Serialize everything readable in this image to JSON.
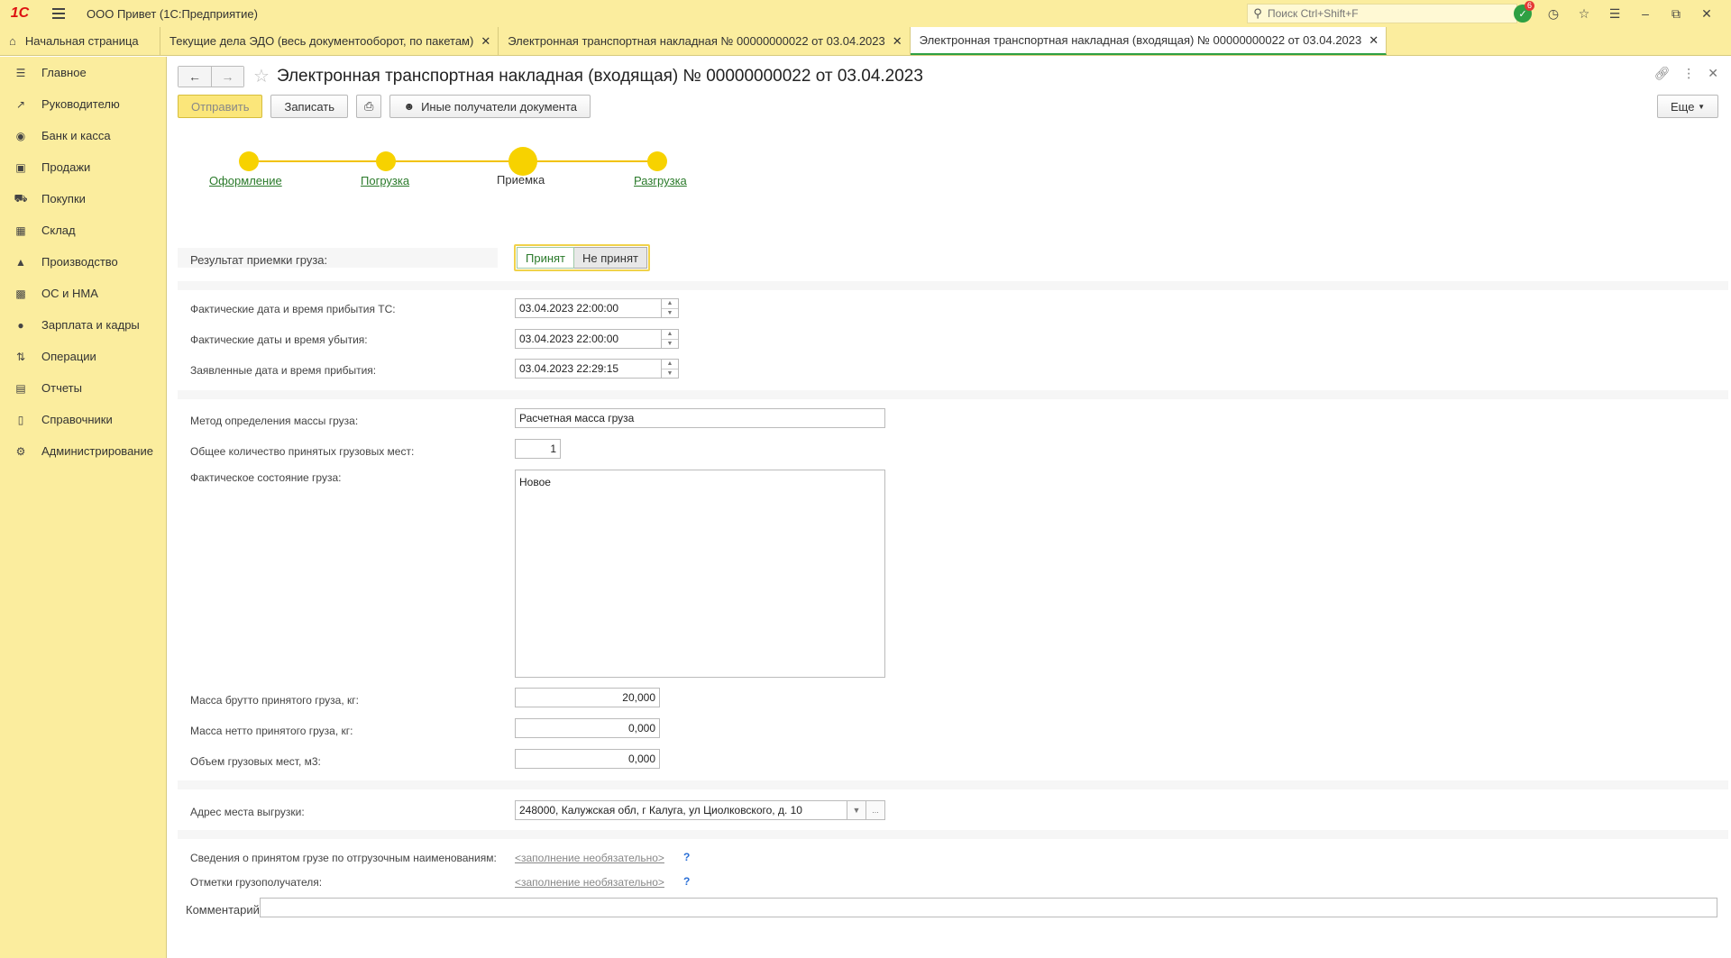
{
  "app": {
    "logo": "1С",
    "title": "ООО Привет  (1С:Предприятие)",
    "search_placeholder": "Поиск Ctrl+Shift+F",
    "notifications_count": "6"
  },
  "tabs": [
    {
      "label": "Начальная страница"
    },
    {
      "label": "Текущие дела ЭДО (весь документооборот, по пакетам)"
    },
    {
      "label": "Электронная транспортная накладная № 00000000022 от 03.04.2023"
    },
    {
      "label": "Электронная транспортная накладная (входящая) № 00000000022 от 03.04.2023"
    }
  ],
  "sidebar": {
    "items": [
      {
        "label": "Главное"
      },
      {
        "label": "Руководителю"
      },
      {
        "label": "Банк и касса"
      },
      {
        "label": "Продажи"
      },
      {
        "label": "Покупки"
      },
      {
        "label": "Склад"
      },
      {
        "label": "Производство"
      },
      {
        "label": "ОС и НМА"
      },
      {
        "label": "Зарплата и кадры"
      },
      {
        "label": "Операции"
      },
      {
        "label": "Отчеты"
      },
      {
        "label": "Справочники"
      },
      {
        "label": "Администрирование"
      }
    ]
  },
  "document": {
    "title": "Электронная транспортная накладная (входящая) № 00000000022 от 03.04.2023",
    "toolbar": {
      "send": "Отправить",
      "save": "Записать",
      "other_recipients": "Иные получатели документа",
      "more": "Еще"
    },
    "steps": [
      {
        "label": "Оформление"
      },
      {
        "label": "Погрузка"
      },
      {
        "label": "Приемка"
      },
      {
        "label": "Разгрузка"
      }
    ],
    "current_step": "Приемка",
    "form": {
      "acceptance_result_label": "Результат приемки груза:",
      "accepted": "Принят",
      "not_accepted": "Не принят",
      "arrival_actual_label": "Фактические дата и время прибытия ТС:",
      "arrival_actual_value": "03.04.2023 22:00:00",
      "departure_actual_label": "Фактические даты и время убытия:",
      "departure_actual_value": "03.04.2023 22:00:00",
      "arrival_declared_label": "Заявленные дата и время прибытия:",
      "arrival_declared_value": "03.04.2023 22:29:15",
      "mass_method_label": "Метод определения массы груза:",
      "mass_method_value": "Расчетная масса груза",
      "places_count_label": "Общее количество принятых грузовых мест:",
      "places_count_value": "1",
      "cargo_state_label": "Фактическое состояние груза:",
      "cargo_state_value": "Новое",
      "gross_label": "Масса брутто принятого груза, кг:",
      "gross_value": "20,000",
      "net_label": "Масса нетто принятого груза, кг:",
      "net_value": "0,000",
      "volume_label": "Объем грузовых мест, м3:",
      "volume_value": "0,000",
      "address_label": "Адрес места выгрузки:",
      "address_value": "248000, Калужская обл, г Калуга, ул Циолковского, д. 10",
      "cargo_info_label": "Сведения о принятом грузе по отгрузочным наименованиям:",
      "cargo_info_link": "<заполнение необязательно>",
      "consignee_marks_label": "Отметки грузополучателя:",
      "consignee_marks_link": "<заполнение необязательно>",
      "help_mark": "?",
      "comment_label": "Комментарий:"
    }
  }
}
